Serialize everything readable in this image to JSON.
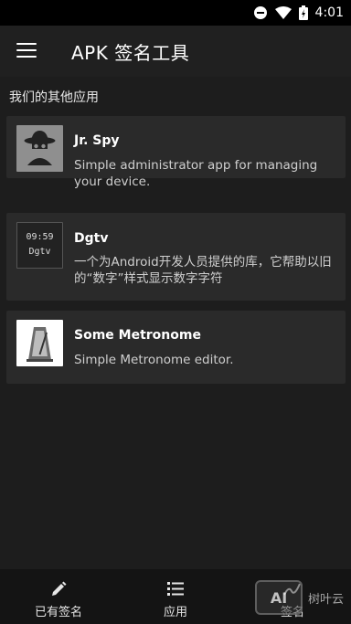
{
  "status_bar": {
    "time": "4:01"
  },
  "app_bar": {
    "title": "APK 签名工具"
  },
  "section": {
    "title": "我们的其他应用"
  },
  "apps": [
    {
      "name": "Jr. Spy",
      "description": "Simple administrator app for managing your device.",
      "icon": "spy-icon"
    },
    {
      "name": "Dgtv",
      "description": "一个为Android开发人员提供的库，它帮助以旧的“数字”样式显示数字字符",
      "icon": "digital-clock-icon",
      "icon_text_top": "09:59",
      "icon_text_bottom": "Dgtv"
    },
    {
      "name": "Some Metronome",
      "description": "Simple Metronome editor.",
      "icon": "metronome-icon"
    }
  ],
  "bottom_nav": [
    {
      "label": "已有签名",
      "icon": "pencil-icon"
    },
    {
      "label": "应用",
      "icon": "list-icon"
    },
    {
      "label": "签名",
      "icon": "signature-icon"
    }
  ],
  "watermark": {
    "badge": "AI",
    "text": "树叶云"
  }
}
